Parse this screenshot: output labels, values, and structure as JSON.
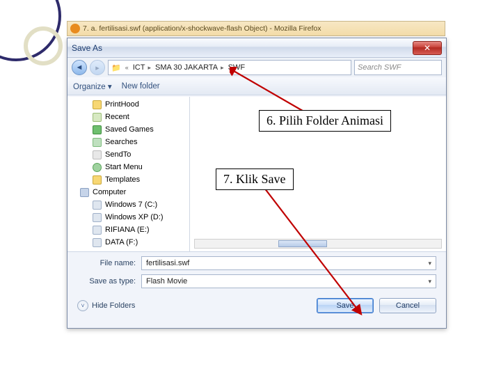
{
  "browser_tab": {
    "title": "7. a. fertilisasi.swf (application/x-shockwave-flash Object) - Mozilla Firefox"
  },
  "dialog": {
    "title": "Save As",
    "close_glyph": "✕",
    "nav_back": "◄",
    "nav_fwd": "▸",
    "breadcrumb_icon": "📁",
    "breadcrumb": [
      "ICT",
      "SMA 30 JAKARTA",
      "SWF"
    ],
    "search_placeholder": "Search SWF",
    "toolbar": {
      "organize": "Organize ▾",
      "new_folder": "New folder"
    },
    "tree": [
      {
        "label": "PrintHood",
        "icon": "folder",
        "indent": true
      },
      {
        "label": "Recent",
        "icon": "recent",
        "indent": true
      },
      {
        "label": "Saved Games",
        "icon": "saved",
        "indent": true
      },
      {
        "label": "Searches",
        "icon": "search",
        "indent": true
      },
      {
        "label": "SendTo",
        "icon": "send",
        "indent": true
      },
      {
        "label": "Start Menu",
        "icon": "menu",
        "indent": true
      },
      {
        "label": "Templates",
        "icon": "templ",
        "indent": true
      },
      {
        "label": "Computer",
        "icon": "comp",
        "indent": false
      },
      {
        "label": "Windows 7 (C:)",
        "icon": "drive",
        "indent": true
      },
      {
        "label": "Windows XP (D:)",
        "icon": "drive",
        "indent": true
      },
      {
        "label": "RIFIANA (E:)",
        "icon": "drive",
        "indent": true
      },
      {
        "label": "DATA (F:)",
        "icon": "drive",
        "indent": true
      }
    ],
    "file_name_label": "File name:",
    "file_name_value": "fertilisasi.swf",
    "save_type_label": "Save as type:",
    "save_type_value": "Flash Movie",
    "hide_folders": "Hide Folders",
    "save_btn": "Save",
    "cancel_btn": "Cancel"
  },
  "callouts": {
    "step6": "6. Pilih Folder Animasi",
    "step7": "7. Klik Save"
  }
}
